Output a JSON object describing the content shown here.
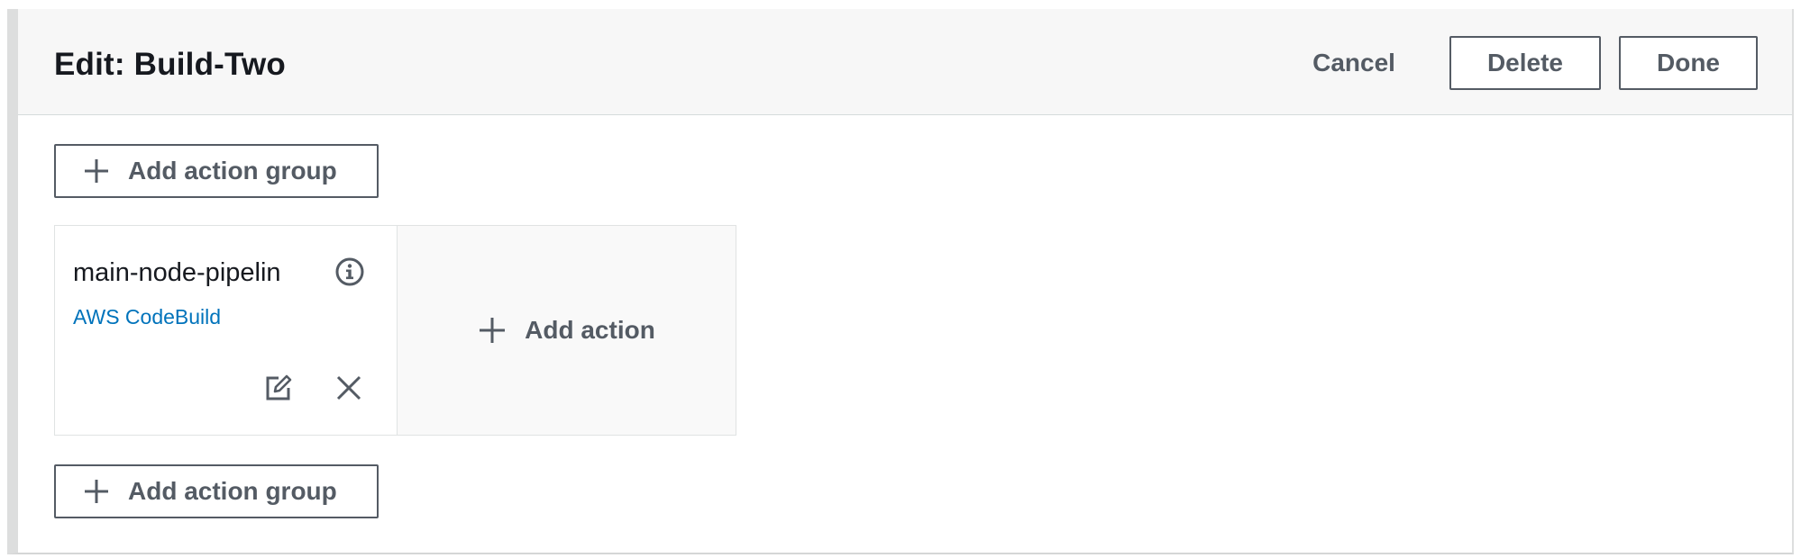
{
  "header": {
    "title": "Edit: Build-Two",
    "cancel_label": "Cancel",
    "delete_label": "Delete",
    "done_label": "Done"
  },
  "stage": {
    "add_group_top_label": "Add action group",
    "add_group_bottom_label": "Add action group",
    "action": {
      "name": "main-node-pipelin",
      "provider": "AWS CodeBuild",
      "info_icon": "info-icon",
      "edit_icon": "edit-icon",
      "delete_icon": "close-icon"
    },
    "add_action_label": "Add action"
  },
  "colors": {
    "button_text": "#545b64",
    "link": "#0073bb",
    "header_bg": "#f7f7f7"
  }
}
